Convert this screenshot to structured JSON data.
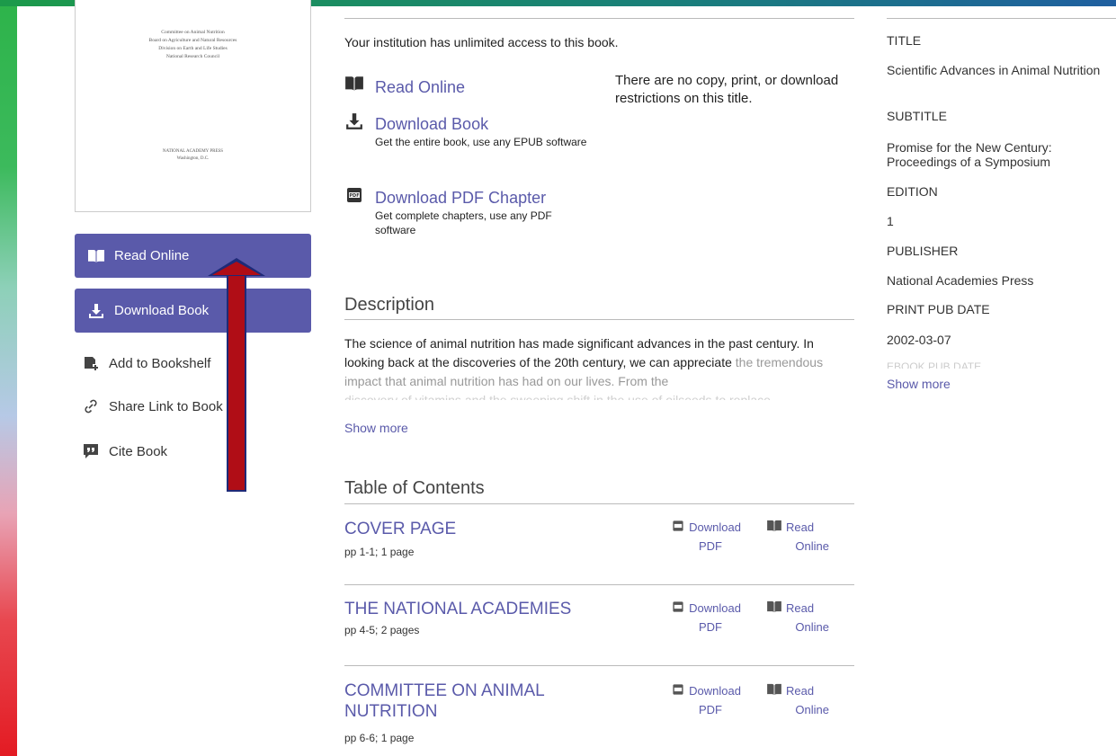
{
  "cover": {
    "lines": [
      "Committee on Animal Nutrition",
      "Board on Agriculture and Natural Resources",
      "Division on Earth and Life Studies",
      "National Research Council"
    ],
    "publisher_lines": [
      "NATIONAL ACADEMY PRESS",
      "Washington, D.C."
    ]
  },
  "sidebar": {
    "read_online": "Read Online",
    "download_book": "Download Book",
    "add_bookshelf": "Add to Bookshelf",
    "share_link": "Share Link to Book",
    "cite_book": "Cite Book"
  },
  "access": {
    "message": "Your institution has unlimited access to this book.",
    "restrictions": "There are no copy, print, or download restrictions on this title.",
    "options": [
      {
        "title": "Read Online",
        "sub": ""
      },
      {
        "title": "Download Book",
        "sub": "Get the entire book, use any EPUB software"
      },
      {
        "title": "Download PDF Chapter",
        "sub": "Get complete chapters, use any PDF software"
      }
    ]
  },
  "description": {
    "heading": "Description",
    "line1": "The science of animal nutrition has made significant advances in the past century. In looking back at the discoveries of the 20th century, we can appreciate",
    "line2": "the tremendous impact that animal nutrition has had on our lives. From the",
    "line3": "discovery of vitamins and the sweeping shift in the use of oilseeds to replace",
    "show_more": "Show more"
  },
  "toc": {
    "heading": "Table of Contents",
    "download_label": "Download",
    "pdf_label": "PDF",
    "read_label": "Read",
    "online_label": "Online",
    "items": [
      {
        "title": "COVER PAGE",
        "pages": "pp 1-1; 1 page"
      },
      {
        "title": "THE NATIONAL ACADEMIES",
        "pages": "pp 4-5; 2 pages"
      },
      {
        "title": "COMMITTEE ON ANIMAL NUTRITION",
        "pages": "pp 6-6; 1 page"
      }
    ]
  },
  "metadata": {
    "title_label": "TITLE",
    "title": "Scientific Advances in Animal Nutrition",
    "subtitle_label": "SUBTITLE",
    "subtitle": "Promise for the New Century: Proceedings of a Symposium",
    "edition_label": "EDITION",
    "edition": "1",
    "publisher_label": "PUBLISHER",
    "publisher": "National Academies Press",
    "print_date_label": "PRINT PUB DATE",
    "print_date": "2002-03-07",
    "ebook_date_label": "EBOOK PUB DATE",
    "show_more": "Show more"
  },
  "colors": {
    "accent": "#5a5aaa",
    "arrow": "#b00d16"
  }
}
